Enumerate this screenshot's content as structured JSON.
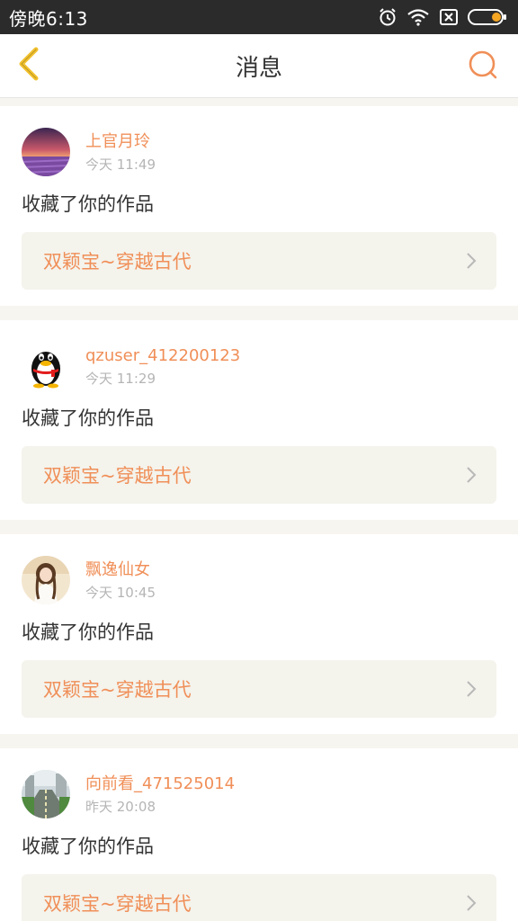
{
  "status_bar": {
    "time": "傍晚6:13"
  },
  "header": {
    "title": "消息"
  },
  "messages": [
    {
      "username": "上官月玲",
      "time": "今天 11:49",
      "action": "收藏了你的作品",
      "work_title": "双颖宝~穿越古代",
      "avatar": "sunset-lavender-avatar"
    },
    {
      "username": "qzuser_412200123",
      "time": "今天 11:29",
      "action": "收藏了你的作品",
      "work_title": "双颖宝~穿越古代",
      "avatar": "qq-penguin-avatar"
    },
    {
      "username": "飘逸仙女",
      "time": "今天 10:45",
      "action": "收藏了你的作品",
      "work_title": "双颖宝~穿越古代",
      "avatar": "girl-photo-avatar"
    },
    {
      "username": "向前看_471525014",
      "time": "昨天 20:08",
      "action": "收藏了你的作品",
      "work_title": "双颖宝~穿越古代",
      "avatar": "city-road-avatar"
    }
  ],
  "colors": {
    "accent": "#f08f58",
    "status_bar": "#2b2b2b",
    "link_bg": "#f4f3ec",
    "back_arrow": "#f2c12e"
  }
}
